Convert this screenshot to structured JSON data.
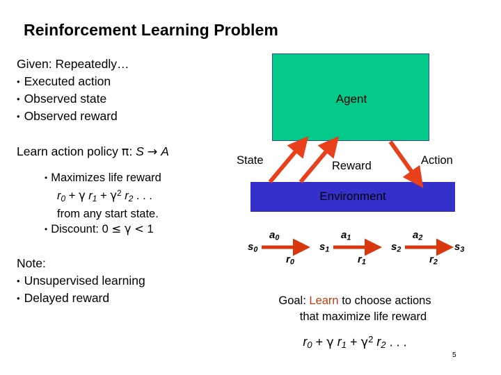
{
  "slide": {
    "title": "Reinforcement Learning Problem",
    "page_number": "5",
    "accent_colors": {
      "agent_fill": "#03C98B",
      "agent_border": "#2b4ea2",
      "environment_fill": "#3330CC",
      "arrow": "#E8401A",
      "highlight": "#C03A12"
    }
  },
  "left": {
    "given_heading": "Given: Repeatedly…",
    "given_bullets": [
      "Executed action",
      "Observed state",
      "Observed reward"
    ],
    "policy_line": {
      "prefix": "Learn action policy ",
      "pi": "π",
      "colon": ": ",
      "domain": "S",
      "arrow": "→",
      "range": "A"
    },
    "policy_bullets": [
      {
        "label": "Maximizes life reward",
        "formula": {
          "t0_var": "r",
          "t0_sub": "0",
          "plus1": "+",
          "g1": "γ",
          "t1_var": "r",
          "t1_sub": "1",
          "plus2": "+",
          "g2": "γ",
          "g2_sup": "2",
          "t2_var": "r",
          "t2_sub": "2",
          "tail": ". . ."
        },
        "continuation": "from any start state."
      },
      {
        "label_prefix": "Discount: 0 ",
        "leq": "≤",
        "gamma": "γ",
        "lt": "<",
        "one": "1"
      }
    ],
    "note_heading": "Note:",
    "note_bullets": [
      "Unsupervised learning",
      "Delayed reward"
    ]
  },
  "diagram": {
    "agent_label": "Agent",
    "environment_label": "Environment",
    "flow_labels": {
      "state": "State",
      "reward": "Reward",
      "action": "Action"
    },
    "sequence": {
      "states": [
        {
          "name": "s",
          "sub": "0"
        },
        {
          "name": "s",
          "sub": "1"
        },
        {
          "name": "s",
          "sub": "2"
        },
        {
          "name": "s",
          "sub": "3"
        }
      ],
      "actions": [
        {
          "name": "a",
          "sub": "0"
        },
        {
          "name": "a",
          "sub": "1"
        },
        {
          "name": "a",
          "sub": "2"
        }
      ],
      "rewards": [
        {
          "name": "r",
          "sub": "0"
        },
        {
          "name": "r",
          "sub": "1"
        },
        {
          "name": "r",
          "sub": "2"
        }
      ]
    },
    "goal": {
      "prefix": "Goal: ",
      "highlight": "Learn",
      "suffix": " to choose actions",
      "line2": "that maximize life reward"
    },
    "bottom_formula": {
      "t0_var": "r",
      "t0_sub": "0",
      "plus1": "+",
      "g1": "γ",
      "t1_var": "r",
      "t1_sub": "1",
      "plus2": "+",
      "g2": "γ",
      "g2_sup": "2",
      "t2_var": "r",
      "t2_sub": "2",
      "tail": ". . ."
    }
  }
}
